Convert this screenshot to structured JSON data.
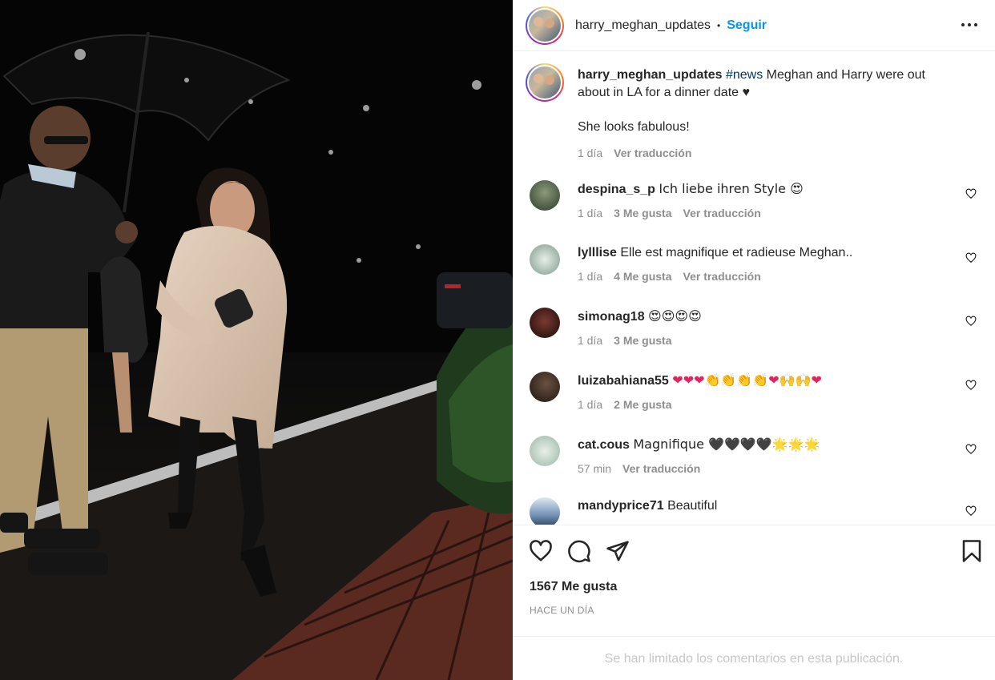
{
  "post": {
    "author": "harry_meghan_updates",
    "separator": "•",
    "follow_label": "Seguir",
    "caption_hashtag": "#news",
    "caption_text": "Meghan and Harry were out about in LA for a dinner date ♥",
    "caption_second": "She looks fabulous!",
    "caption_time": "1 día",
    "caption_translate": "Ver traducción"
  },
  "comments": [
    {
      "user": "despina_s_p",
      "text": "Ich liebe ihren Style 😍",
      "time": "1 día",
      "likes": "3 Me gusta",
      "translate": "Ver traducción",
      "avatar_color": "#3b4a3a"
    },
    {
      "user": "lylllise",
      "text": "Elle est magnifique et radieuse Meghan..",
      "time": "1 día",
      "likes": "4 Me gusta",
      "translate": "Ver traducción",
      "avatar_color": "#9fb3a8"
    },
    {
      "user": "simonag18",
      "text": "😍😍😍😍",
      "time": "1 día",
      "likes": "3 Me gusta",
      "translate": "",
      "avatar_color": "#3a1c1c"
    },
    {
      "user": "luizabahiana55",
      "text": "❤❤❤👏👏👏👏❤🙌🙌❤",
      "time": "1 día",
      "likes": "2 Me gusta",
      "translate": "",
      "avatar_color": "#2a2420"
    },
    {
      "user": "cat.cous",
      "text": "Magnifique 🖤🖤🖤🖤🌟🌟🌟",
      "time": "57 min",
      "likes": "",
      "translate": "Ver traducción",
      "avatar_color": "#b9cfc4"
    },
    {
      "user": "mandyprice71",
      "text": "Beautiful",
      "time": "",
      "likes": "",
      "translate": "",
      "avatar_color": "#6f8fb3"
    }
  ],
  "actions": {
    "like_icon": "heart-icon",
    "comment_icon": "comment-icon",
    "share_icon": "share-icon",
    "save_icon": "bookmark-icon"
  },
  "likes_count": "1567 Me gusta",
  "posted_time": "HACE UN DÍA",
  "comments_limited": "Se han limitado los comentarios en esta publicación."
}
